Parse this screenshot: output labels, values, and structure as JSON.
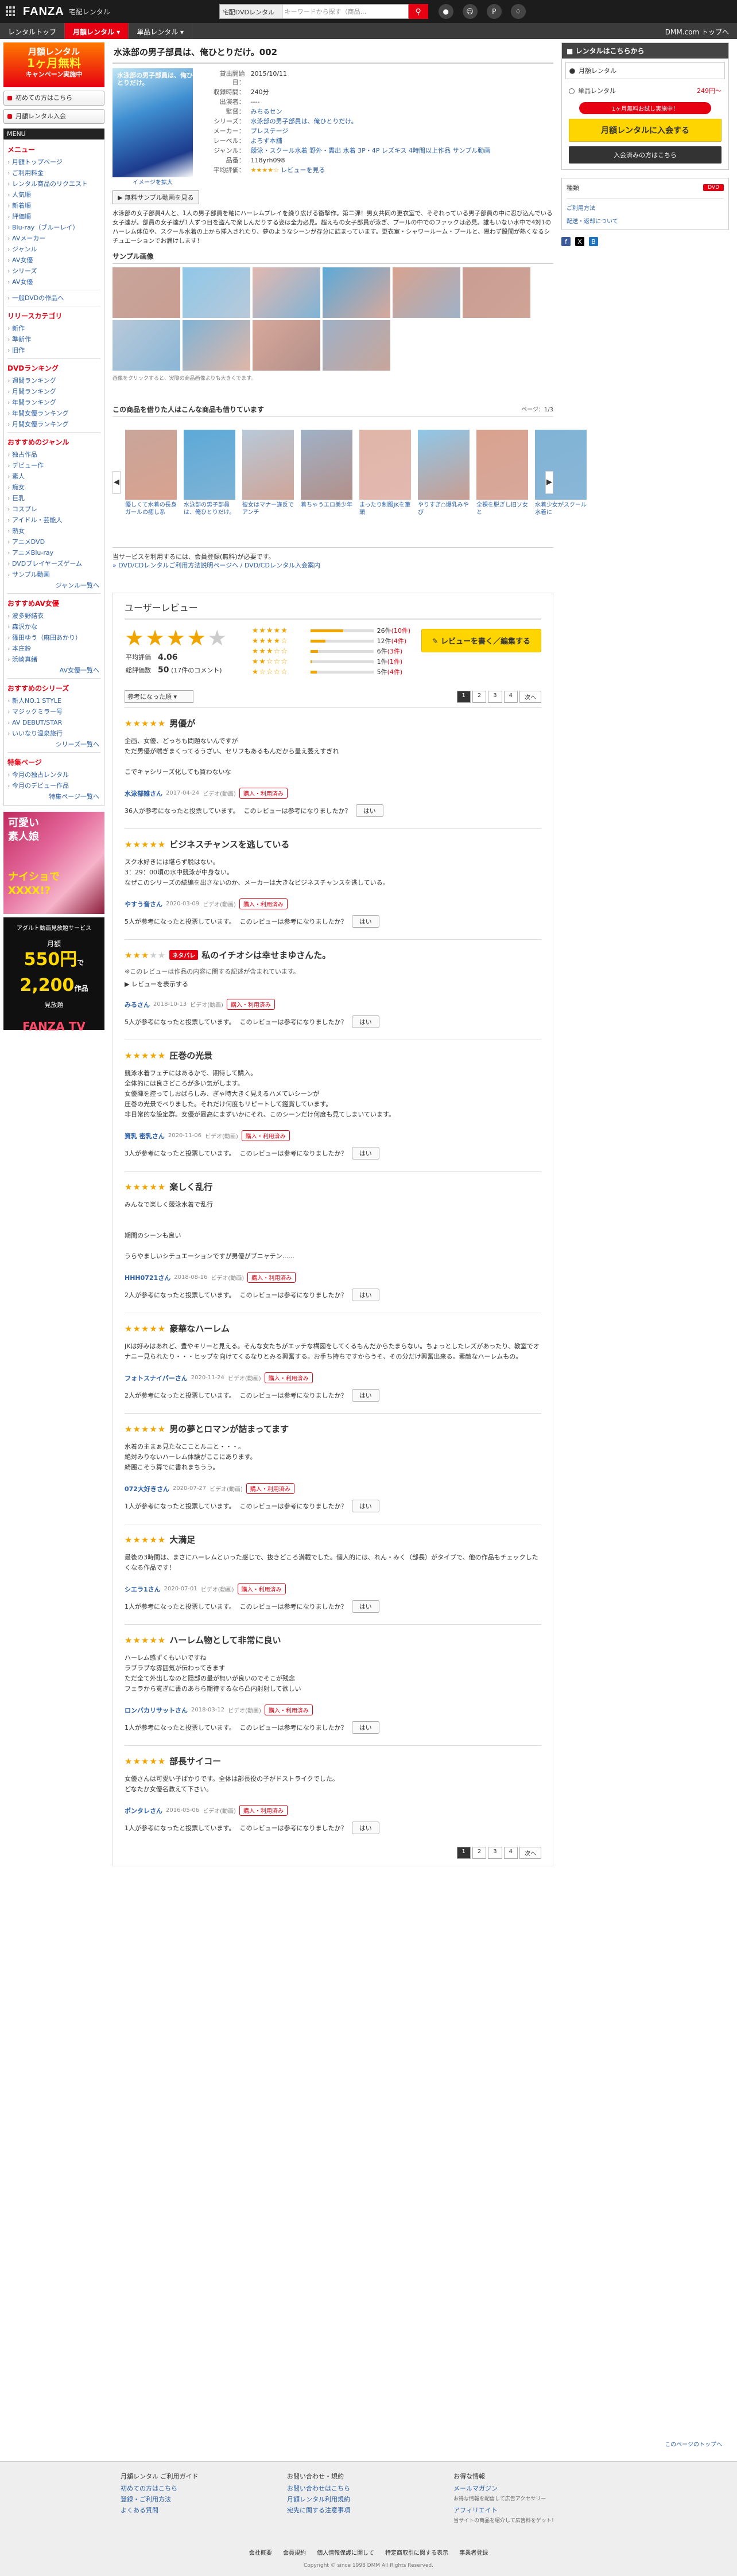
{
  "header": {
    "logo_main": "FANZA",
    "logo_sub": "宅配レンタル",
    "search_scope": "宅配DVDレンタル",
    "search_placeholder": "キーワードから探す（商品...",
    "nav": [
      "レンタルトップ",
      "月額レンタル ▾",
      "単品レンタル ▾"
    ],
    "dmm": "DMM.com トップへ"
  },
  "left": {
    "campaign_l1": "月額レンタル",
    "campaign_l2": "1ヶ月無料",
    "campaign_l3": "キャンペーン実施中",
    "btn1": "初めての方はこちら",
    "btn2": "月額レンタル入会",
    "menu_title": "MENU",
    "menu_head": "メニュー",
    "menu": [
      "月額トップページ",
      "ご利用料金",
      "レンタル商品のリクエスト",
      "人気順",
      "新着順",
      "評価順",
      "Blu-ray（ブルーレイ）",
      "AVメーカー",
      "ジャンル",
      "AV女優",
      "シリーズ",
      "AV女優"
    ],
    "menu_dvd": "一般DVDの作品へ",
    "release_head": "リリースカテゴリ",
    "release": [
      "新作",
      "準新作",
      "旧作"
    ],
    "ranking_head": "DVDランキング",
    "ranking": [
      "週間ランキング",
      "月間ランキング",
      "年間ランキング",
      "年間女優ランキング",
      "月間女優ランキング"
    ],
    "genre_head": "おすすめのジャンル",
    "genre": [
      "独占作品",
      "デビュー作",
      "素人",
      "痴女",
      "巨乳",
      "コスプレ",
      "アイドル・芸能人",
      "熟女",
      "アニメDVD",
      "アニメBlu-ray",
      "DVDプレイヤーズゲーム",
      "サンプル動画"
    ],
    "genre_more": "ジャンル一覧へ",
    "actress_head": "おすすめAV女優",
    "actress": [
      "波多野結衣",
      "森沢かな",
      "篠田ゆう（麻田あかり）",
      "本庄鈴",
      "浜崎真緒"
    ],
    "actress_more": "AV女優一覧へ",
    "series_head": "おすすめのシリーズ",
    "series": [
      "新人NO.1 STYLE",
      "マジックミラー号",
      "AV DEBUT/STAR",
      "いいなり温泉旅行"
    ],
    "series_more": "シリーズ一覧へ",
    "feature_head": "特集ページ",
    "feature": [
      "今月の独占レンタル",
      "今月のデビュー作品"
    ],
    "feature_more": "特集ページ一覧へ",
    "ad1_l1": "可愛い",
    "ad1_l2": "素人娘",
    "ad1_l3": "ナイショで",
    "ad1_l4": "XXXX!?",
    "ad2_top": "アダルト動画見放題サービス",
    "ad2_l1": "月額",
    "ad2_price": "550円",
    "ad2_l2": "で",
    "ad2_count": "2,200",
    "ad2_l3": "作品",
    "ad2_l4": "見放題",
    "ad2_logo": "FANZA TV"
  },
  "product": {
    "title": "水泳部の男子部員は、俺ひとりだけ。002",
    "pkg_title": "水泳部の男子部員は、俺ひとりだけ。",
    "img_link": "イメージを拡大",
    "sample_btn": "無料サンプル動画を見る",
    "info": [
      [
        "貸出開始日：",
        "2015/10/11"
      ],
      [
        "収録時間：",
        "240分"
      ],
      [
        "出演者：",
        "----"
      ],
      [
        "監督：",
        "みちるセン"
      ],
      [
        "シリーズ：",
        "水泳部の男子部員は、俺ひとりだけ。"
      ],
      [
        "メーカー：",
        "プレステージ"
      ],
      [
        "レーベル：",
        "よろず本舗"
      ],
      [
        "ジャンル：",
        "競泳・スクール水着 野外・露出 水着 3P・4P レズキス 4時間以上作品 サンプル動画"
      ],
      [
        "品番：",
        "118yrh098"
      ],
      [
        "平均評価：",
        "レビューを見る"
      ]
    ],
    "desc": "水泳部の女子部員4人と、1人の男子部員を軸にハーレムプレイを繰り広げる衝撃作。第二弾！男女共同の更衣室で、そぞれっている男子部員の中に忍び込んでいる女子達が。部員の女子達が1人ずつ目を盗んで楽しんだりする姿は全力必見。超えもの女子部員が泳ぎ、プールの中でのファックは必見。誰もいない水中で4対1のハーレム体位や、スクール水着の上から挿入されたり、夢のようなシーンが存分に詰まっています。更衣室・シャワールーム・プールと、思わず股間が熱くなるシチュエーションでお届けします！",
    "sample_head": "サンプル画像",
    "thumb_note": "画像をクリックすると、実際の商品画像よりも大きくでます。",
    "rel_head": "この商品を借りた人はこんな商品も借りています",
    "rel_count": "ページ：1/3",
    "rel": [
      "優しくて水着の長身ガールの癒し系",
      "水泳部の男子部員は、俺ひとりだけ。",
      "彼女はマナー違反でアンチ",
      "着ちゃうエロ美少年",
      "まったり制服JKを筆頭",
      "やりすぎ○爆乳みやび",
      "全裸を脱ぎし旧ソ女と",
      "水着少女がスクール水着に"
    ],
    "notice_l1": "当サービスを利用するには、会員登録(無料)が必要です。",
    "notice_l2": "» DVD/CDレンタルご利用方法説明ページへ / DVD/CDレンタル入会案内"
  },
  "reviews": {
    "head": "ユーザーレビュー",
    "avg_label": "平均評価",
    "avg": "4.06",
    "total_label": "総評価数",
    "total": "50",
    "total_sub": "(17件のコメント)",
    "dist": [
      {
        "stars": "★★★★★",
        "count": "26件",
        "c": "(10件)",
        "frac": 0.52
      },
      {
        "stars": "★★★★☆",
        "count": "12件",
        "c": "(4件)",
        "frac": 0.24
      },
      {
        "stars": "★★★☆☆",
        "count": "6件",
        "c": "(3件)",
        "frac": 0.12
      },
      {
        "stars": "★★☆☆☆",
        "count": "1件",
        "c": "(1件)",
        "frac": 0.02
      },
      {
        "stars": "★☆☆☆☆",
        "count": "5件",
        "c": "(4件)",
        "frac": 0.1
      }
    ],
    "write_btn": "レビューを書く／編集する",
    "sort": "参考になった順",
    "pages": [
      "1",
      "2",
      "3",
      "4",
      "次へ"
    ],
    "help_q": "このレビューは参考になりましたか？",
    "help_btn": "はい",
    "spoil_note": "※このレビューは作品の内容に関する記述が含まれています。",
    "spoil_toggle": "レビューを表示する",
    "items": [
      {
        "stars": 5,
        "title": "男優が",
        "body": "企画、女優、どっちも問題ないんですが\nただ男優が喘ぎまくってるうざい、セリフもあるもんだから量え萎えすぎれ\n\nこでキャシリーズ化しても買わないな",
        "author": "水泳部雑さん",
        "date": "2017-04-24",
        "type": "ビデオ(動画)",
        "badge": "購入・利用済み",
        "helpful": "36人が参考になったと投票しています。"
      },
      {
        "stars": 5,
        "title": "ビジネスチャンスを逃している",
        "body": "スク水好きには堪らず脱はない。\n3：29：00頃の水中競泳が中身ない。\nなぜこのシリーズの続編を出さないのか、メーカーは大きなビジネスチャンスを逃している。",
        "author": "やすう音さん",
        "date": "2020-03-09",
        "type": "ビデオ(動画)",
        "badge": "購入・利用済み",
        "helpful": "5人が参考になったと投票しています。"
      },
      {
        "stars": 3,
        "title": "私のイチオシは幸せまゆさんた。",
        "spoiler": true,
        "body": "",
        "author": "みるさん",
        "date": "2018-10-13",
        "type": "ビデオ(動画)",
        "badge": "購入・利用済み",
        "helpful": "5人が参考になったと投票しています。"
      },
      {
        "stars": 5,
        "title": "圧巻の光景",
        "body": "競泳水着フェチにはあるかで、期待して購入。\n全体的には良さどころが多い気がします。\n女優陣を控ってしおばらしみ、ぎゃ時大きく見えるハメていシーンが\n圧巻の光景でべりました。それだけ何度もリピートして鑑賞しています。\n非日常的な設定群。女優が最高にまずいかにそれ、このシーンだけ何度も見てしまいています。",
        "author": "資乳 密乳さん",
        "date": "2020-11-06",
        "type": "ビデオ(動画)",
        "badge": "購入・利用済み",
        "helpful": "3人が参考になったと投票しています。"
      },
      {
        "stars": 5,
        "title": "楽しく乱行",
        "body": "みんなで楽しく競泳水着で乱行\n\n\n期間のシーンも良い\n\nうらやましいシチュエーションですが男優がブニャチン......",
        "author": "HHH0721さん",
        "date": "2018-08-16",
        "type": "ビデオ(動画)",
        "badge": "購入・利用済み",
        "helpful": "2人が参考になったと投票しています。"
      },
      {
        "stars": 5,
        "title": "豪華なハーレム",
        "body": "JKは好みはあれど、豊やキリーと見える。そんな女たちがエッチな構図をしてくるもんだからたまらない。ちょっとしたレズがあったり、教室でオナニー見られたり・・・ヒップを向けてくるなりとみる興奮する。お手ち持ちですからうそ、その分だけ興奮出来る。素敵なハーレムもの。",
        "author": "フォトスナイパーさん",
        "date": "2020-11-24",
        "type": "ビデオ(動画)",
        "badge": "購入・利用済み",
        "helpful": "2人が参考になったと投票しています。"
      },
      {
        "stars": 5,
        "title": "男の夢とロマンが詰まってます",
        "body": "水着の主まぁ見たなこことルニと・・・。\n絶対みりないハーレム体験がここにあります。\n綺麗こそう算でに書れまちうう。",
        "author": "072大好きさん",
        "date": "2020-07-27",
        "type": "ビデオ(動画)",
        "badge": "購入・利用済み",
        "helpful": "1人が参考になったと投票しています。"
      },
      {
        "stars": 5,
        "title": "大満足",
        "body": "最後の3時間は、まさにハーレムといった感じで、抜きどころ満載でした。個人的には、れん・みく（部長）がタイプで、他の作品もチェックしたくなる作品です！",
        "author": "シエラ1さん",
        "date": "2020-07-01",
        "type": "ビデオ(動画)",
        "badge": "購入・利用済み",
        "helpful": "1人が参考になったと投票しています。"
      },
      {
        "stars": 5,
        "title": "ハーレム物として非常に良い",
        "body": "ハーレム感ずくもいいですね\nラブラブな雰囲気が伝わってきます\nただ全て外出しなのと隠部の量が無いが良いのでそこが残念\nフェラから寛ぎに書のあちら期待するなら凸内射射して欲しい",
        "author": "ロンバカリサットさん",
        "date": "2018-03-12",
        "type": "ビデオ(動画)",
        "badge": "購入・利用済み",
        "helpful": "1人が参考になったと投票しています。"
      },
      {
        "stars": 5,
        "title": "部長サイコー",
        "body": "女優さんは可愛い子ばかりです。全体は部長役の子がドストライクでした。\nどなたか女優名教えて下さい。",
        "author": "ポンタレさん",
        "date": "2016-05-06",
        "type": "ビデオ(動画)",
        "badge": "購入・利用済み",
        "helpful": "1人が参考になったと投票しています。"
      }
    ]
  },
  "right": {
    "head": "レンタルはこちらから",
    "opt1": "月額レンタル",
    "opt2": "単品レンタル",
    "opt2_price": "249円〜",
    "free": "1ヶ月無料お試し実施中！",
    "join": "月額レンタルに入会する",
    "member": "入会済みの方はこちら",
    "type_label": "種類",
    "type_val": "DVD",
    "link1": "ご利用方法",
    "link2": "配送・返却について"
  },
  "footer": {
    "col1_head": "月額レンタル ご利用ガイド",
    "col1": [
      "初めての方はこちら",
      "登録・ご利用方法",
      "よくある質問"
    ],
    "col2_head": "お問い合わせ・規約",
    "col2": [
      "お問い合わせはこちら",
      "月額レンタル利用規約",
      "宛先に関する注意事項"
    ],
    "col3_head": "お得な情報",
    "col3": [
      "メールマガジン",
      "お得な情報を配信して広告アクセサリー",
      "アフィリエイト",
      "当サイトの商品を紹介して広告料をゲット！"
    ],
    "bottom": [
      "会社概要",
      "会員規約",
      "個人情報保護に関して",
      "特定商取引に関する表示",
      "事業者登録"
    ],
    "copy": "Copyright © since 1998 DMM All Rights Reserved.",
    "pagetop": "このページのトップへ"
  },
  "colors": {
    "accent": "#e60012",
    "star": "#f0a400",
    "cta": "#ffd500"
  }
}
